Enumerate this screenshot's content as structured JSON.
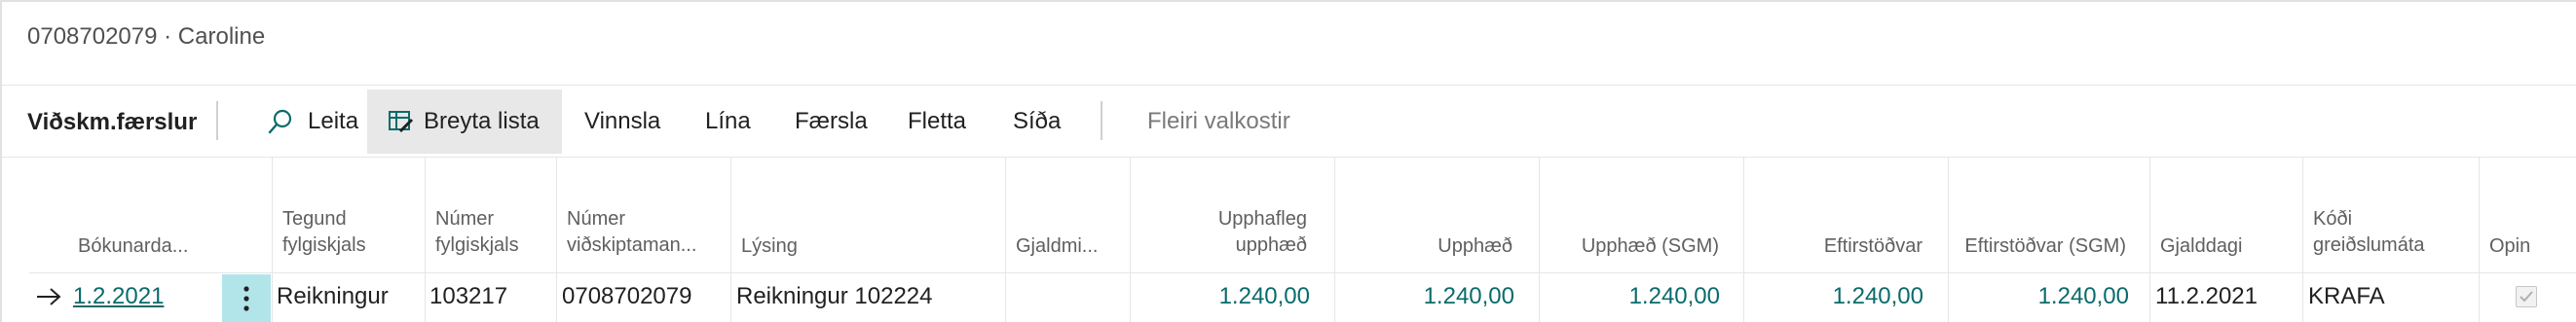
{
  "page": {
    "title": "0708702079 · Caroline"
  },
  "toolbar": {
    "title": "Viðskm.færslur",
    "search_label": "Leita",
    "edit_list_label": "Breyta lista",
    "actions": [
      "Vinnsla",
      "Lína",
      "Færsla",
      "Fletta",
      "Síða"
    ],
    "more_options_label": "Fleiri valkostir"
  },
  "table": {
    "headers": {
      "posting_date": "Bókunarda...",
      "doc_type": [
        "Tegund",
        "fylgiskjals"
      ],
      "doc_no": [
        "Númer",
        "fylgiskjals"
      ],
      "customer_no": [
        "Númer",
        "viðskiptaman..."
      ],
      "description": "Lýsing",
      "currency": "Gjaldmi...",
      "original_amount": [
        "Upphafleg",
        "upphæð"
      ],
      "amount": "Upphæð",
      "amount_lcy": "Upphæð (SGM)",
      "remaining": "Eftirstöðvar",
      "remaining_lcy": "Eftirstöðvar (SGM)",
      "due_date": "Gjalddagi",
      "payment_method": [
        "Kóði",
        "greiðslumáta"
      ],
      "open": "Opin"
    },
    "rows": [
      {
        "posting_date": "1.2.2021",
        "doc_type": "Reikningur",
        "doc_no": "103217",
        "customer_no": "0708702079",
        "description": "Reikningur 102224",
        "currency": "",
        "original_amount": "1.240,00",
        "amount": "1.240,00",
        "amount_lcy": "1.240,00",
        "remaining": "1.240,00",
        "remaining_lcy": "1.240,00",
        "due_date": "11.2.2021",
        "payment_method": "KRAFA",
        "open": true
      }
    ]
  },
  "colors": {
    "accent": "#0a6b6b",
    "selected_cell": "#b2e5ea",
    "active_button": "#e8e8e8"
  },
  "icons": {
    "row_indicator": "arrow-right-icon",
    "search": "search-icon",
    "edit_list": "edit-list-icon",
    "row_menu": "more-vertical-icon"
  }
}
